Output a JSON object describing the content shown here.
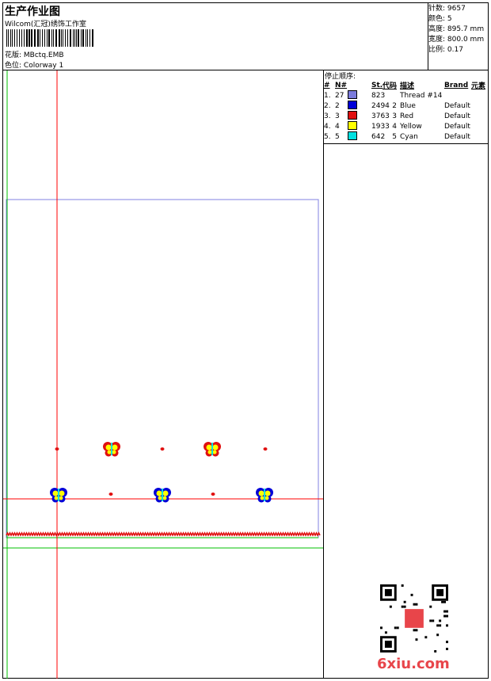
{
  "header": {
    "title": "生产作业图",
    "company": "Wilcom(汇冠)绣饰工作室",
    "design_label": "花版:",
    "design_value": "MBctq.EMB",
    "colorway_label": "色位:",
    "colorway_value": "Colorway 1"
  },
  "stats": [
    {
      "label": "针数:",
      "value": "9657"
    },
    {
      "label": "颜色:",
      "value": "5"
    },
    {
      "label": "高度:",
      "value": "895.7 mm"
    },
    {
      "label": "宽度:",
      "value": "800.0 mm"
    },
    {
      "label": "比例:",
      "value": "0.17"
    }
  ],
  "stop_sequence": {
    "title": "停止顺序:",
    "headers": [
      "#",
      "N#",
      "St.",
      "代码",
      "描述",
      "Brand",
      "元素"
    ],
    "rows": [
      {
        "idx": "1.",
        "n": "27",
        "color": "#7b7bdc",
        "st": "823",
        "code": "",
        "desc": "Thread #14",
        "brand": ""
      },
      {
        "idx": "2.",
        "n": "2",
        "color": "#0000d8",
        "st": "2494",
        "code": "2",
        "desc": "Blue",
        "brand": "Default"
      },
      {
        "idx": "3.",
        "n": "3",
        "color": "#e01010",
        "st": "3763",
        "code": "3",
        "desc": "Red",
        "brand": "Default"
      },
      {
        "idx": "4.",
        "n": "4",
        "color": "#ffff00",
        "st": "1933",
        "code": "4",
        "desc": "Yellow",
        "brand": "Default"
      },
      {
        "idx": "5.",
        "n": "5",
        "color": "#00e0e0",
        "st": "642",
        "code": "5",
        "desc": "Cyan",
        "brand": "Default"
      }
    ]
  },
  "watermark": "6xiu.com",
  "colors": {
    "guide_red": "#ff0000",
    "guide_green": "#00c000",
    "frame_blue": "#8080e0",
    "stitch_red": "#e01010",
    "butterfly_blue": "#0000d8",
    "butterfly_red": "#e01010",
    "butterfly_yellow": "#ffff00",
    "butterfly_cyan": "#00e0e0"
  }
}
